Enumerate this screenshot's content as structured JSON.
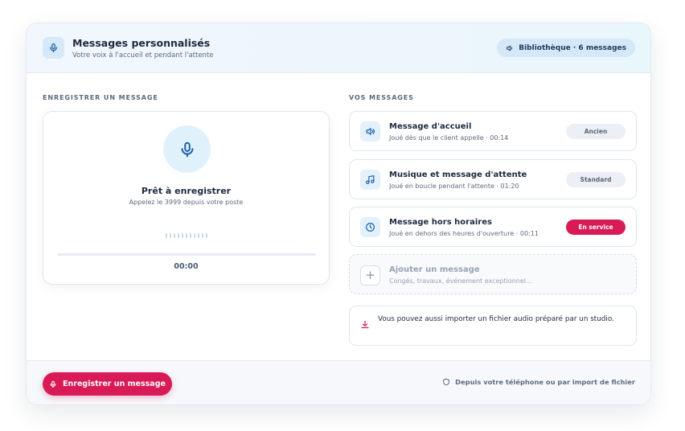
{
  "header": {
    "title": "Messages personnalisés",
    "subtitle": "Votre voix à l'accueil et pendant l'attente",
    "library_label": "Bibliothèque · 6 messages"
  },
  "record_section": {
    "label": "ENREGISTRER UN MESSAGE",
    "status_title": "Prêt à enregistrer",
    "status_sub": "Appelez le 3999 depuis votre poste",
    "timer": "00:00",
    "progress": 0
  },
  "messages_section": {
    "label": "VOS MESSAGES",
    "items": [
      {
        "title": "Message d'accueil",
        "subtitle": "Joué dès que le client appelle · 00:14",
        "badge": "Ancien",
        "icon": "speaker-icon"
      },
      {
        "title": "Musique et message d'attente",
        "subtitle": "Joué en boucle pendant l'attente · 01:20",
        "badge": "Standard",
        "icon": "music-note-icon"
      },
      {
        "title": "Message hors horaires",
        "subtitle": "Joué en dehors des heures d'ouverture · 00:11",
        "badge": "En service",
        "icon": "clock-icon"
      }
    ],
    "add": {
      "title": "Ajouter un message",
      "subtitle": "Congés, travaux, événement exceptionnel..."
    },
    "import_text": "Vous pouvez aussi importer un fichier audio préparé par un studio."
  },
  "footer": {
    "record_button": "Enregistrer un message",
    "note": "Depuis votre téléphone ou par import de fichier"
  },
  "colors": {
    "accent": "#d81b56",
    "icon_blue": "#1e5fa8",
    "badge_neutral": "#eceff3"
  }
}
